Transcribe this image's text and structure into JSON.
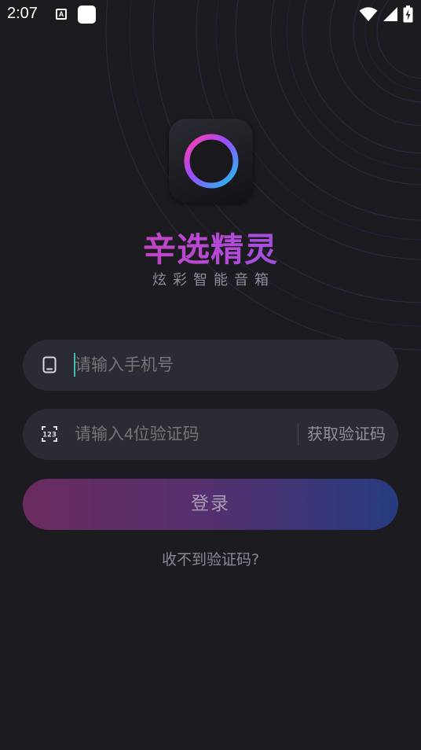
{
  "status_bar": {
    "time": "2:07",
    "notification_icon": "A",
    "icons": [
      "wifi-icon",
      "signal-icon",
      "battery-charging-icon"
    ]
  },
  "app": {
    "title": "辛选精灵",
    "subtitle": "炫彩智能音箱",
    "logo_icon": "ring-logo-icon"
  },
  "form": {
    "phone": {
      "icon": "phone-icon",
      "placeholder": "请输入手机号",
      "value": ""
    },
    "code": {
      "icon": "numeric-keypad-icon",
      "icon_text": "123",
      "placeholder": "请输入4位验证码",
      "value": "",
      "get_code_label": "获取验证码"
    },
    "login_label": "登录",
    "no_code_label": "收不到验证码?"
  },
  "colors": {
    "background": "#1b1b20",
    "field_background": "#2a2b33",
    "title_gradient_start": "#d63aa2",
    "title_gradient_end": "#6b5ce8",
    "login_gradient_start": "#6b2b60",
    "login_gradient_end": "#253c80",
    "caret": "#3fbfa8"
  }
}
